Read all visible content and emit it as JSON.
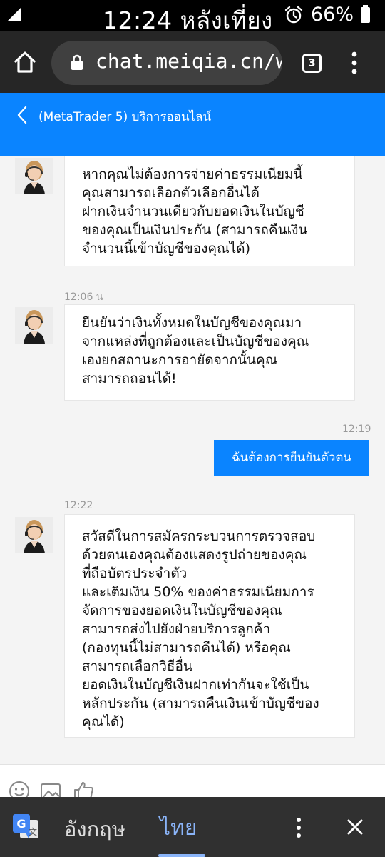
{
  "status_bar": {
    "time": "12:24 หลังเที่ยง",
    "battery": "66%",
    "icons": [
      "signal-icon",
      "alarm-icon",
      "battery-icon"
    ]
  },
  "browser": {
    "url": "chat.meiqia.cn/w",
    "tab_count": "3",
    "icons": [
      "home-icon",
      "lock-icon",
      "menu-icon"
    ]
  },
  "chat": {
    "title": "(MetaTrader 5) บริการออนไลน์",
    "accent_color": "#0a84ff",
    "messages": [
      {
        "sender": "agent",
        "lines": [
          "หากคุณไม่ต้องการจ่ายค่าธรรมเนียมนี้",
          "คุณสามารถเลือกตัวเลือกอื่นได้",
          "ฝากเงินจำนวนเดียวกับยอดเงินในบัญชี",
          "ของคุณเป็นเงินประกัน (สามารถคืนเงิน",
          "จำนวนนี้เข้าบัญชีของคุณได้)"
        ]
      },
      {
        "sender": "agent",
        "time": "12:06 น",
        "lines": [
          "ยืนยันว่าเงินทั้งหมดในบัญชีของคุณมา",
          "จากแหล่งที่ถูกต้องและเป็นบัญชีของคุณ",
          "เองยกสถานะการอายัดจากนั้นคุณ",
          "สามารถถอนได้!"
        ]
      },
      {
        "sender": "user",
        "time": "12:19",
        "text": "ฉันต้องการยืนยันตัวตน"
      },
      {
        "sender": "agent",
        "time": "12:22",
        "lines": [
          "สวัสดีในการสมัครกระบวนการตรวจสอบ",
          "ด้วยตนเองคุณต้องแสดงรูปถ่ายของคุณ",
          "ที่ถือบัตรประจำตัว",
          "และเติมเงิน 50% ของค่าธรรมเนียมการ",
          "จัดการของยอดเงินในบัญชีของคุณ",
          "สามารถส่งไปยังฝ่ายบริการลูกค้า",
          "(กองทุนนี้ไม่สามารถคืนได้) หรือคุณ",
          "สามารถเลือกวิธีอื่น",
          "ยอดเงินในบัญชีเงินฝากเท่ากันจะใช้เป็น",
          "หลักประกัน (สามารถคืนเงินเข้าบัญชีของ",
          "คุณได้)"
        ]
      }
    ]
  },
  "toolbar": {
    "icons": [
      "emoji-icon",
      "image-icon",
      "thumbs-up-icon"
    ]
  },
  "translate_bar": {
    "source_lang": "อังกฤษ",
    "target_lang": "ไทย",
    "icons": [
      "google-translate-icon",
      "more-icon",
      "close-icon"
    ]
  }
}
